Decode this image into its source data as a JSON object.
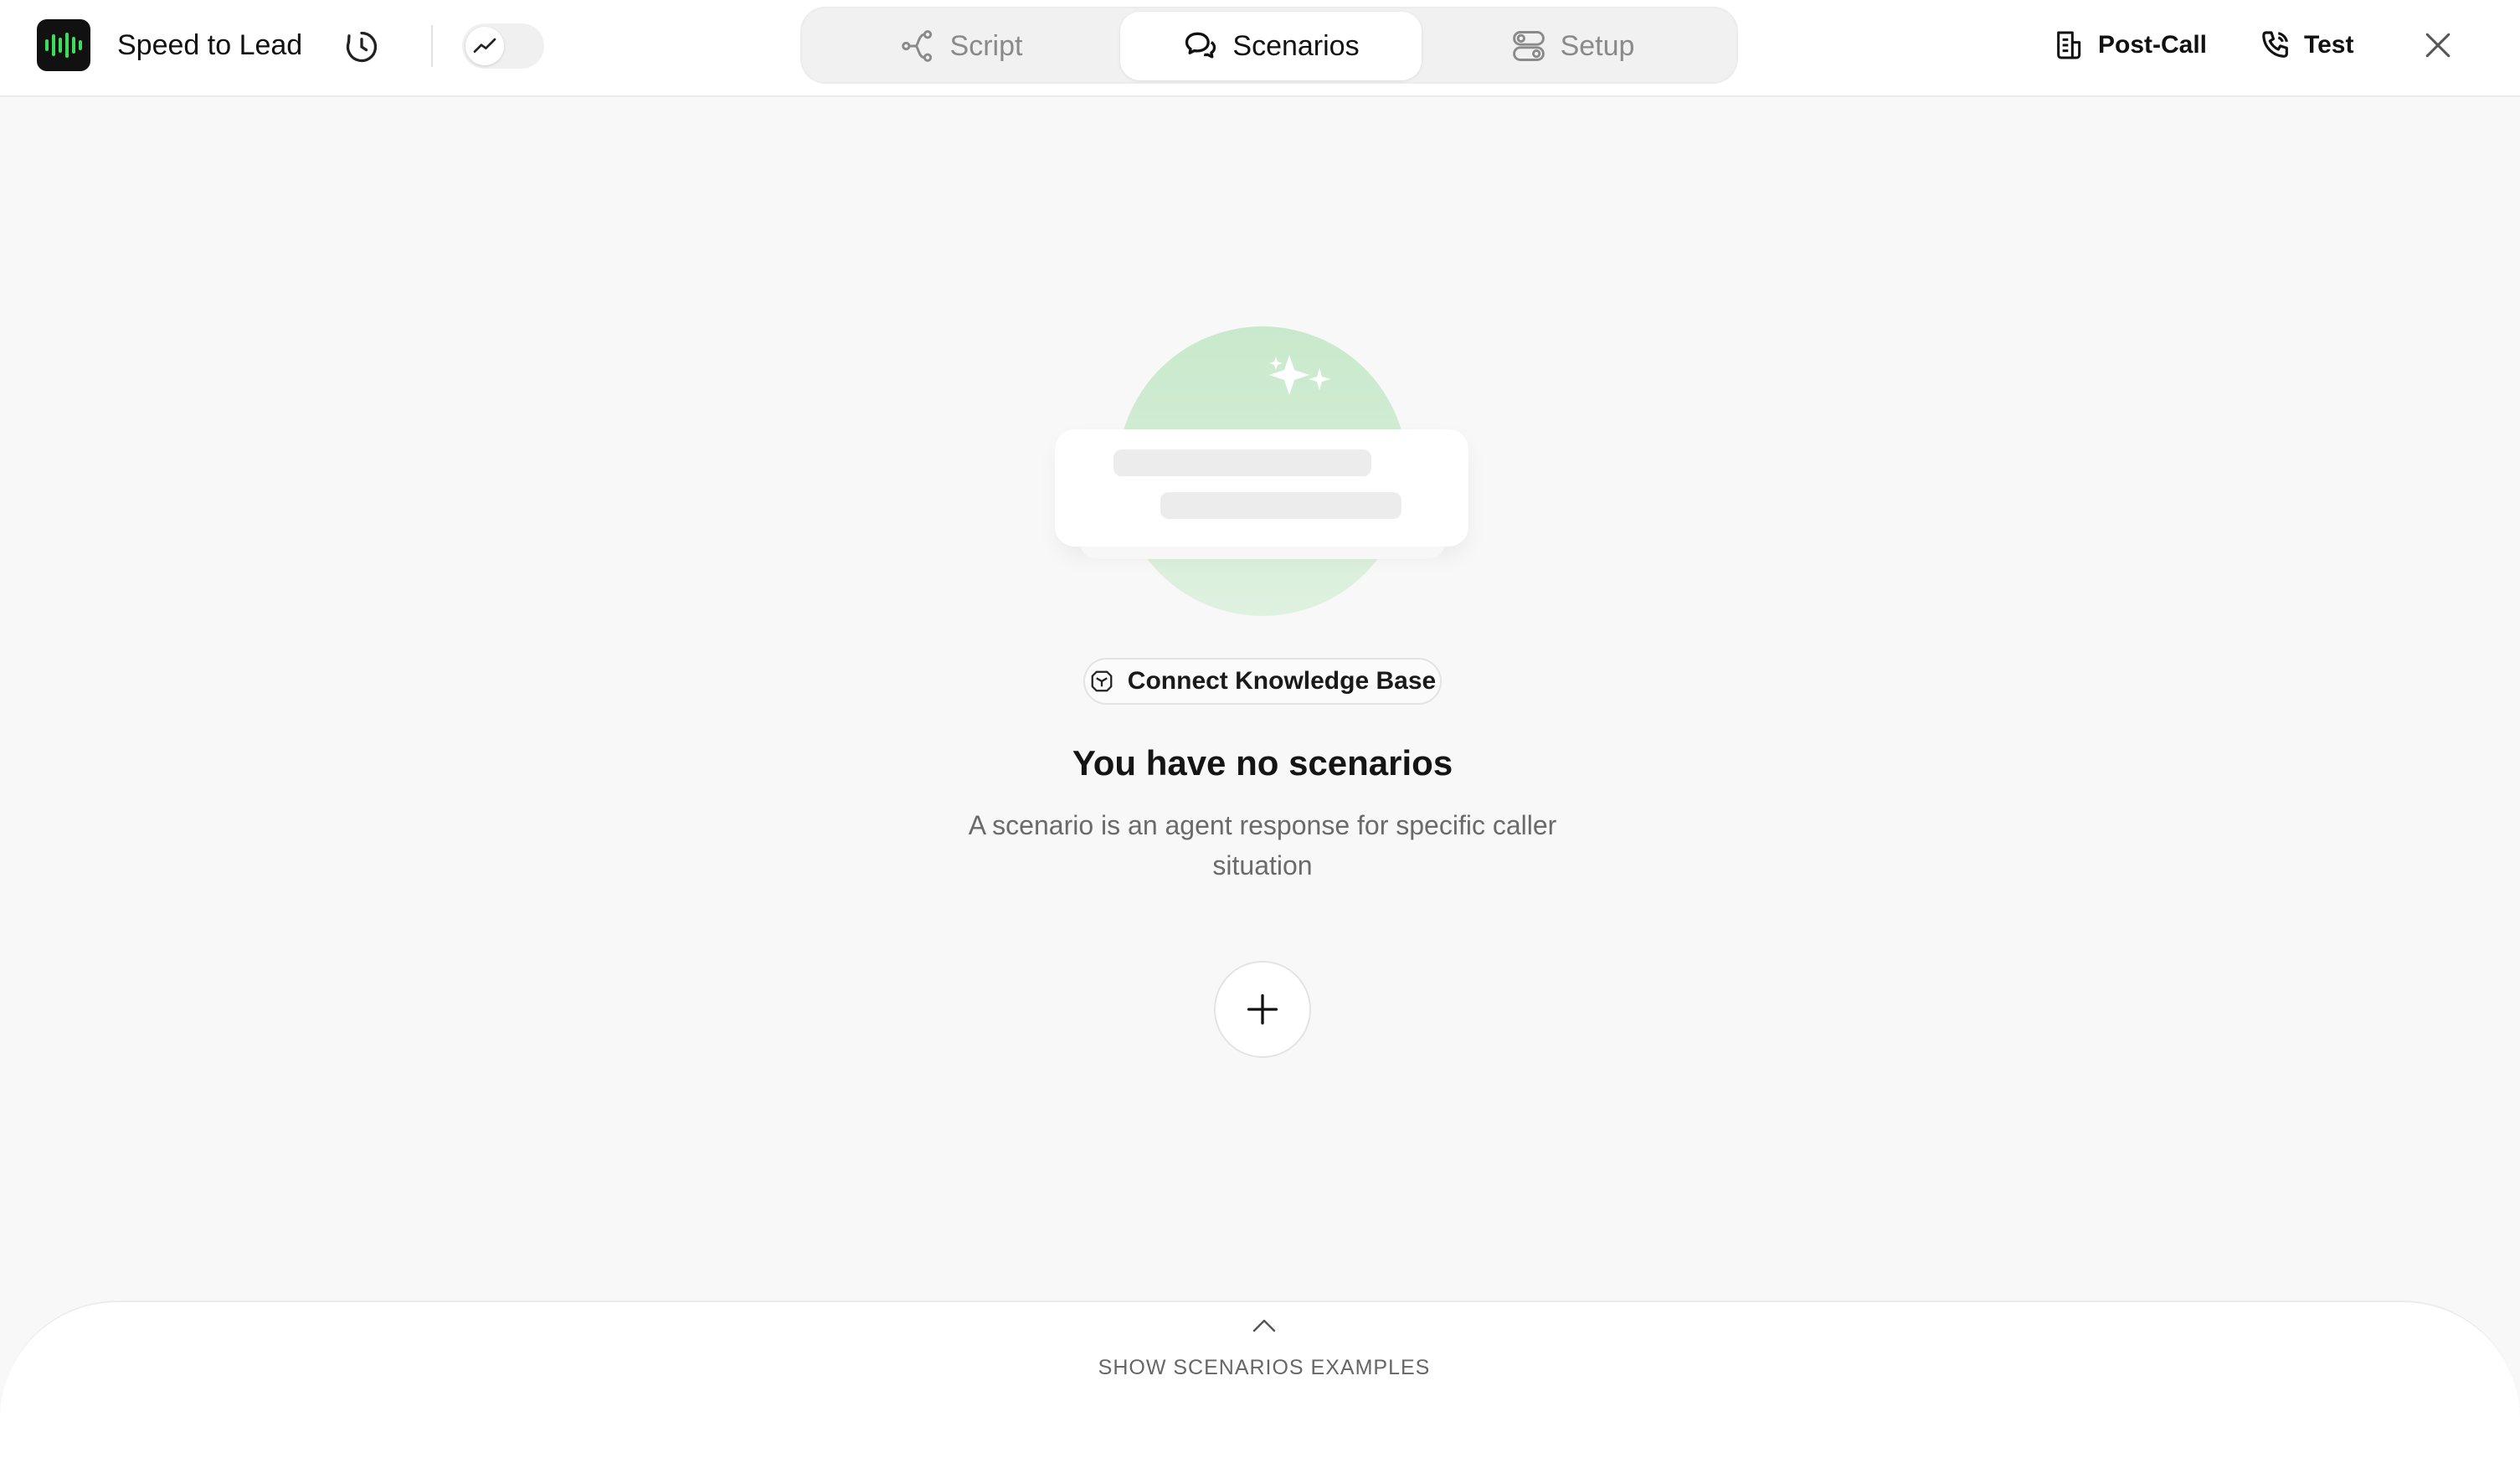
{
  "header": {
    "app_title": "Speed to Lead",
    "logo_icon": "waveform-icon",
    "brand_color": "#3ddc5c",
    "tabs": [
      {
        "label": "Script",
        "icon": "flow-icon",
        "active": false
      },
      {
        "label": "Scenarios",
        "icon": "chat-icon",
        "active": true
      },
      {
        "label": "Setup",
        "icon": "toggles-icon",
        "active": false
      }
    ],
    "post_call_label": "Post-Call",
    "test_label": "Test"
  },
  "empty_state": {
    "connect_kb_label": "Connect Knowledge Base",
    "title": "You have no scenarios",
    "description": "A scenario is an agent response for specific caller situation",
    "illustration_color": "#c9e9cd"
  },
  "footer": {
    "show_examples_label": "SHOW SCENARIOS EXAMPLES"
  }
}
